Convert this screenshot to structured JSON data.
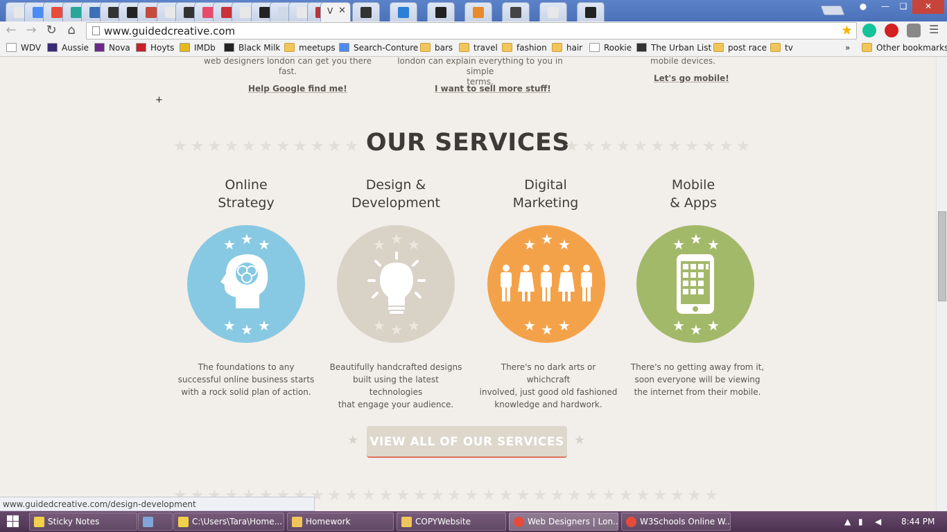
{
  "browser": {
    "active_tab_label": "V",
    "url": "www.guidedcreative.com",
    "tab_favicon_colors": [
      "#e8e8e8",
      "#4b8bf4",
      "#e84b3a",
      "#2aa59a",
      "#3c6fb5",
      "#333333",
      "#222222",
      "#c44b3a",
      "#e8e8e8",
      "#333333",
      "#e84b6a",
      "#c8323a",
      "#e8e8e8",
      "#222222",
      "#cfd8e6",
      "#e8e8e8",
      "#b8373a",
      "#2f6fb5",
      "#333333",
      "#2a7fd6",
      "#222222",
      "#e88a2a",
      "#444444",
      "#e8e8e8",
      "#222222"
    ],
    "bookmarks": [
      {
        "label": "WDV",
        "icon": "page-icon"
      },
      {
        "label": "Aussie",
        "icon": "aussie-icon"
      },
      {
        "label": "Nova",
        "icon": "nova-icon"
      },
      {
        "label": "Hoyts",
        "icon": "hoyts-icon"
      },
      {
        "label": "IMDb",
        "icon": "imdb-icon"
      },
      {
        "label": "Black Milk",
        "icon": "blackmilk-icon"
      },
      {
        "label": "meetups",
        "icon": "folder-icon"
      },
      {
        "label": "Search-Conture",
        "icon": "google-icon"
      },
      {
        "label": "bars",
        "icon": "folder-icon"
      },
      {
        "label": "travel",
        "icon": "folder-icon"
      },
      {
        "label": "fashion",
        "icon": "folder-icon"
      },
      {
        "label": "hair",
        "icon": "folder-icon"
      },
      {
        "label": "Rookie",
        "icon": "rookie-icon"
      },
      {
        "label": "The Urban List",
        "icon": "urbanlist-icon"
      },
      {
        "label": "post race",
        "icon": "folder-icon"
      },
      {
        "label": "tv",
        "icon": "folder-icon"
      }
    ],
    "overflow_label": "»",
    "other_bookmarks": "Other bookmarks",
    "status_url": "www.guidedcreative.com/design-development"
  },
  "page": {
    "top_snippets": [
      {
        "text_lines": [
          "web designers london can get you there",
          "fast."
        ],
        "link": "Help Google find me!"
      },
      {
        "text_lines": [
          "london can explain everything to you in simple",
          "terms."
        ],
        "link": "I want to sell more stuff!"
      },
      {
        "text_lines": [
          "mobile devices."
        ],
        "link": "Let's go mobile!"
      }
    ],
    "services_title": "OUR SERVICES",
    "services": [
      {
        "title_lines": [
          "Online",
          "Strategy"
        ],
        "icon": "head-brain-icon",
        "color": "#87c9e2",
        "desc_lines": [
          "The foundations to any",
          "successful online business starts",
          "with a rock solid plan of action."
        ]
      },
      {
        "title_lines": [
          "Design &",
          "Development"
        ],
        "icon": "lightbulb-icon",
        "color": "#d9d2c6",
        "desc_lines": [
          "Beautifully handcrafted designs",
          "built using the latest technologies",
          "that engage your audience."
        ]
      },
      {
        "title_lines": [
          "Digital",
          "Marketing"
        ],
        "icon": "people-icon",
        "color": "#f4a24a",
        "desc_lines": [
          "There's no dark arts or whichcraft",
          "involved, just good old fashioned",
          "knowledge and hardwork."
        ]
      },
      {
        "title_lines": [
          "Mobile",
          "& Apps"
        ],
        "icon": "mobile-phone-icon",
        "color": "#a3b96a",
        "desc_lines": [
          "There's no getting away from it,",
          "soon everyone will be viewing",
          "the internet from their mobile."
        ]
      }
    ],
    "cta_label": "VIEW ALL OF OUR SERVICES",
    "star_color": "#e2ddd6",
    "title_color": "#3d3a37"
  },
  "taskbar": {
    "items": [
      {
        "label": "Sticky Notes",
        "icon": "sticky-notes-icon",
        "color": "#f2d04a"
      },
      {
        "label": "",
        "icon": "calculator-icon",
        "color": "#7fa6d6"
      },
      {
        "label": "C:\\Users\\Tara\\Home...",
        "icon": "notepad-icon",
        "color": "#f2d04a"
      },
      {
        "label": "Homework",
        "icon": "folder-icon",
        "color": "#f0c65b"
      },
      {
        "label": "COPYWebsite",
        "icon": "folder-icon",
        "color": "#f0c65b"
      },
      {
        "label": "Web Designers | Lon...",
        "icon": "chrome-icon",
        "color": "#e84b3a"
      },
      {
        "label": "W3Schools Online W...",
        "icon": "chrome-icon",
        "color": "#e84b3a"
      }
    ],
    "clock": "8:44 PM"
  }
}
